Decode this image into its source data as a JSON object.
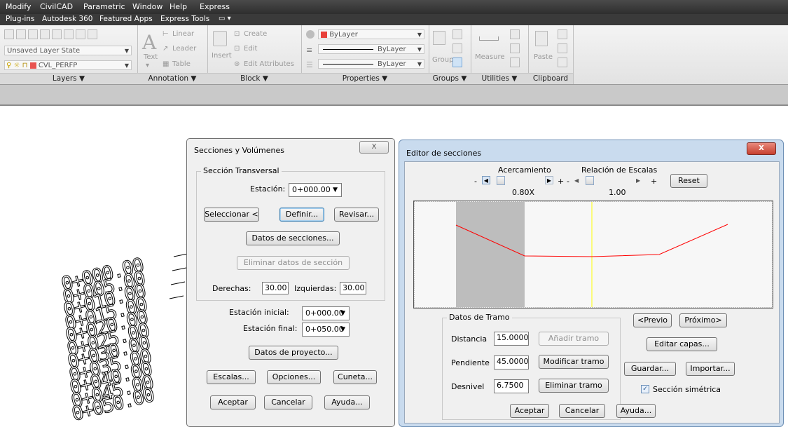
{
  "menubar": {
    "items": [
      "Modify",
      "CivilCAD",
      "Parametric",
      "Window",
      "Help",
      "Express"
    ]
  },
  "tabbar": {
    "items": [
      "Plug-ins",
      "Autodesk 360",
      "Featured Apps",
      "Express Tools"
    ]
  },
  "ribbon": {
    "layers": {
      "title": "Layers ▼",
      "layer_state": "Unsaved Layer State",
      "current_layer": "CVL_PERFP"
    },
    "annotation": {
      "title": "Annotation ▼",
      "text_label": "Text",
      "linear_label": "Linear",
      "leader_label": "Leader",
      "table_label": "Table"
    },
    "block": {
      "title": "Block ▼",
      "insert_label": "Insert",
      "create_label": "Create",
      "edit_label": "Edit",
      "edit_attributes_label": "Edit Attributes"
    },
    "properties": {
      "title": "Properties ▼",
      "color": "ByLayer",
      "lineweight": "ByLayer",
      "linetype": "ByLayer"
    },
    "groups": {
      "title": "Groups ▼",
      "group_label": "Group"
    },
    "utilities": {
      "title": "Utilities ▼",
      "measure_label": "Measure"
    },
    "clipboard": {
      "title": "Clipboard",
      "paste_label": "Paste"
    }
  },
  "drawing": {
    "station_labels": [
      "0+000.00",
      "0+005.00",
      "0+010.00",
      "0+015.00",
      "0+020.00",
      "0+025.00",
      "0+030.00",
      "0+035.00",
      "0+040.00",
      "0+045.00",
      "0+050.00"
    ]
  },
  "secciones_dialog": {
    "title": "Secciones y Volúmenes",
    "close_glyph": "X",
    "group_title": "Sección Transversal",
    "estacion_label": "Estación:",
    "estacion_value": "0+000.00",
    "seleccionar_label": "Seleccionar <",
    "definir_label": "Definir...",
    "revisar_label": "Revisar...",
    "datos_secciones_label": "Datos de secciones...",
    "eliminar_label": "Eliminar datos de sección",
    "derechas_label": "Derechas:",
    "derechas_value": "30.00",
    "izquierdas_label": "Izquierdas:",
    "izquierdas_value": "30.00",
    "estacion_inicial_label": "Estación inicial:",
    "estacion_inicial_value": "0+000.00",
    "estacion_final_label": "Estación final:",
    "estacion_final_value": "0+050.00",
    "datos_proyecto_label": "Datos de proyecto...",
    "escalas_label": "Escalas...",
    "opciones_label": "Opciones...",
    "cuneta_label": "Cuneta...",
    "aceptar_label": "Aceptar",
    "cancelar_label": "Cancelar",
    "ayuda_label": "Ayuda..."
  },
  "editor_dialog": {
    "title": "Editor de secciones",
    "close_glyph": "X",
    "acercamiento_label": "Acercamiento",
    "relacion_label": "Relación de Escalas",
    "zoom_value": "0.80X",
    "ratio_value": "1.00",
    "zoom_level": 0.1,
    "ratio_level": 0.05,
    "minus": "-",
    "plus": "+",
    "reset_label": "Reset",
    "datos_tramo_title": "Datos de Tramo",
    "distancia_label": "Distancia",
    "distancia_value": "15.0000",
    "pendiente_label": "Pendiente",
    "pendiente_value": "45.0000",
    "desnivel_label": "Desnivel",
    "desnivel_value": "6.7500",
    "anadir_label": "Añadir tramo",
    "modificar_label": "Modificar tramo",
    "eliminar_label": "Eliminar tramo",
    "previo_label": "<Previo",
    "proximo_label": "Próximo>",
    "editar_capas_label": "Editar capas...",
    "guardar_label": "Guardar...",
    "importar_label": "Importar...",
    "simetrica_label": "Sección simétrica",
    "simetrica_checked": true,
    "aceptar_label": "Aceptar",
    "cancelar_label": "Cancelar",
    "ayuda_label": "Ayuda...",
    "colors": {
      "section_line": "#ff0000",
      "axis_line": "#ffff00",
      "shaded_band": "#bdbdbd",
      "close_button": "#c9423a"
    }
  }
}
